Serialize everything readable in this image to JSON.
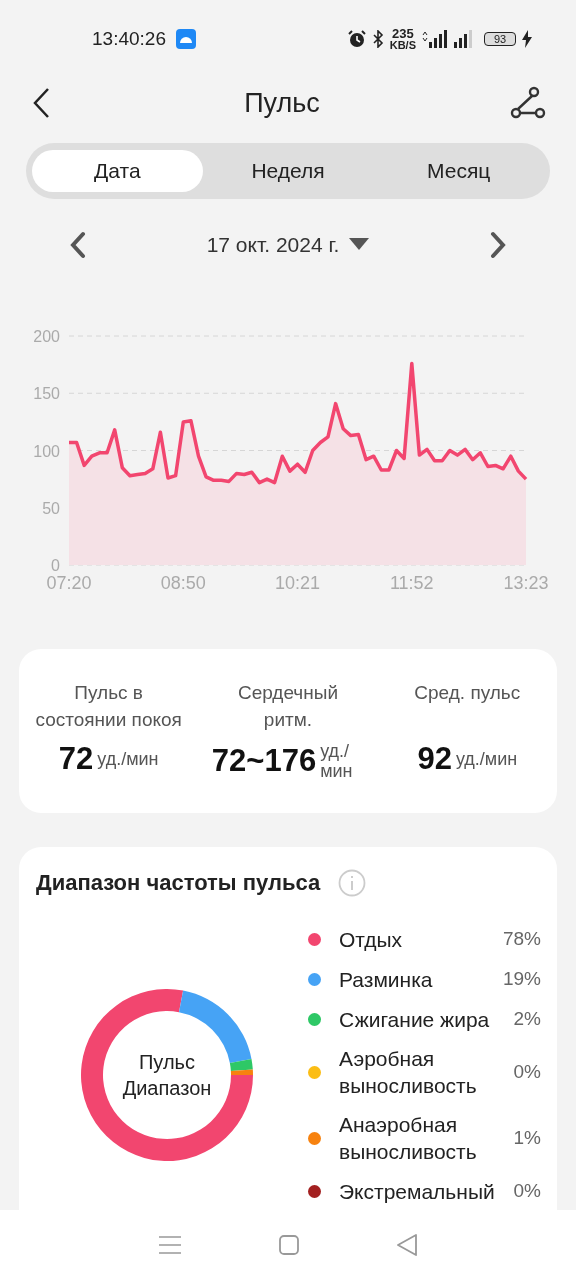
{
  "status_bar": {
    "time": "13:40:26",
    "speed_value": "235",
    "speed_unit": "KB/S",
    "battery": "93"
  },
  "header": {
    "title": "Пульс"
  },
  "tabs": [
    {
      "label": "Дата",
      "selected": true
    },
    {
      "label": "Неделя",
      "selected": false
    },
    {
      "label": "Месяц",
      "selected": false
    }
  ],
  "date_picker": {
    "date": "17 окт. 2024 г."
  },
  "heart_rate_chart": {
    "chart_data": {
      "type": "area",
      "categories": [
        "07:20",
        null,
        null,
        null,
        null,
        null,
        null,
        null,
        null,
        null,
        null,
        null,
        null,
        null,
        null,
        "08:50",
        null,
        null,
        null,
        null,
        null,
        null,
        null,
        null,
        null,
        null,
        null,
        null,
        null,
        null,
        "10:21",
        null,
        null,
        null,
        null,
        null,
        null,
        null,
        null,
        null,
        null,
        null,
        null,
        null,
        null,
        "11:52",
        null,
        null,
        null,
        null,
        null,
        null,
        null,
        null,
        null,
        null,
        null,
        null,
        null,
        null,
        "13:23"
      ],
      "values": [
        107,
        107,
        87,
        95,
        98,
        98,
        118,
        85,
        78,
        79,
        80,
        84,
        116,
        76,
        78,
        125,
        126,
        95,
        77,
        74,
        74,
        73,
        80,
        79,
        81,
        72,
        75,
        72,
        95,
        82,
        88,
        81,
        100,
        107,
        112,
        141,
        119,
        113,
        114,
        92,
        95,
        83,
        83,
        100,
        93,
        176,
        96,
        101,
        91,
        91,
        100,
        96,
        101,
        92,
        98,
        86,
        87,
        84,
        95,
        82,
        75
      ],
      "ylim": [
        0,
        200
      ],
      "yticks": [
        0,
        50,
        100,
        150,
        200
      ]
    }
  },
  "summary": [
    {
      "label": "Пульс в состоянии покоя",
      "value": "72",
      "unit": "уд./мин"
    },
    {
      "label": "Сердечный ритм.",
      "value": "72~176",
      "unit": "уд./мин"
    },
    {
      "label": "Сред. пульс",
      "value": "92",
      "unit": "уд./мин"
    }
  ],
  "zones_card": {
    "title": "Диапазон частоты пульса",
    "chart_data": {
      "type": "donut",
      "title": "Пульс Диапазон",
      "categories": [
        "Отдых",
        "Разминка",
        "Сжигание жира",
        "Аэробная выносливость",
        "Анаэробная выносливость",
        "Экстремальный"
      ],
      "values": [
        78,
        19,
        2,
        0,
        1,
        0
      ]
    },
    "zones": [
      {
        "percent": "78%",
        "color": "#f2466f"
      },
      {
        "percent": "19%",
        "color": "#46a3f5"
      },
      {
        "percent": "2%",
        "color": "#2ec866"
      },
      {
        "percent": "0%",
        "color": "#fbbd14"
      },
      {
        "percent": "1%",
        "color": "#f7820f"
      },
      {
        "percent": "0%",
        "color": "#a32020"
      }
    ]
  }
}
